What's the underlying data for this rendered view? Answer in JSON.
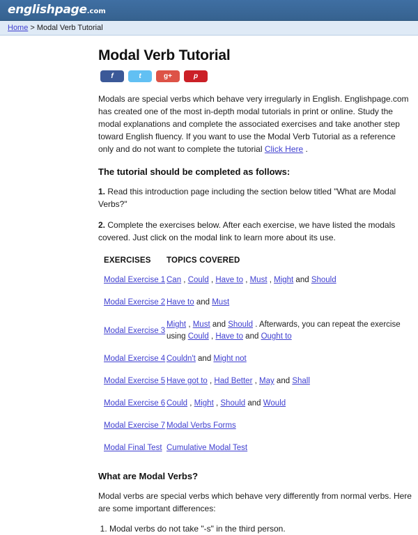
{
  "site": {
    "logo_name": "englishpage",
    "logo_tld": ".com"
  },
  "breadcrumb": {
    "home_label": "Home",
    "separator": " > ",
    "current": "Modal Verb Tutorial"
  },
  "page": {
    "title": "Modal Verb Tutorial"
  },
  "social": {
    "buttons": [
      {
        "name": "facebook-share-button",
        "label": "f",
        "color": "#3b5998"
      },
      {
        "name": "twitter-share-button",
        "label": "t",
        "color": "#62c0f3"
      },
      {
        "name": "googleplus-share-button",
        "label": "g+",
        "color": "#dd5347"
      },
      {
        "name": "pinterest-share-button",
        "label": "p",
        "color": "#cb2027"
      }
    ]
  },
  "intro": {
    "part1": "Modals are special verbs which behave very irregularly in English. Englishpage.com has created one of the most in-depth modal tutorials in print or online. Study the modal explanations and complete the associated exercises and take another step toward English fluency. If you want to use the Modal Verb Tutorial as a reference only and do not want to complete the tutorial ",
    "click_here": "Click Here",
    "part2": " ."
  },
  "steps": {
    "heading": "The tutorial should be completed as follows:",
    "one_num": "1.",
    "one_text": " Read this introduction page including the section below titled \"What are Modal Verbs?\"",
    "two_num": "2.",
    "two_text": " Complete the exercises below. After each exercise, we have listed the modals covered. Just click on the modal link to learn more about its use."
  },
  "exercises_table": {
    "header_exercises": "EXERCISES",
    "header_topics": "TOPICS COVERED",
    "rows": [
      {
        "exercise": "Modal Exercise 1",
        "topics_plain": "Can , Could , Have to , Must , Might and Should",
        "topics": [
          {
            "text": "Can",
            "link": true
          },
          {
            "text": " , ",
            "link": false
          },
          {
            "text": "Could",
            "link": true
          },
          {
            "text": " , ",
            "link": false
          },
          {
            "text": "Have to",
            "link": true
          },
          {
            "text": " , ",
            "link": false
          },
          {
            "text": "Must",
            "link": true
          },
          {
            "text": " , ",
            "link": false
          },
          {
            "text": "Might",
            "link": true
          },
          {
            "text": " and ",
            "link": false
          },
          {
            "text": "Should",
            "link": true
          }
        ]
      },
      {
        "exercise": "Modal Exercise 2",
        "topics_plain": "Have to and Must",
        "topics": [
          {
            "text": "Have to",
            "link": true
          },
          {
            "text": " and ",
            "link": false
          },
          {
            "text": "Must",
            "link": true
          }
        ]
      },
      {
        "exercise": "Modal Exercise 3",
        "topics_plain": "Might , Must and Should . Afterwards, you can repeat the exercise using Could , Have to and Ought to",
        "topics": [
          {
            "text": "Might",
            "link": true
          },
          {
            "text": " , ",
            "link": false
          },
          {
            "text": "Must",
            "link": true
          },
          {
            "text": " and ",
            "link": false
          },
          {
            "text": "Should",
            "link": true
          },
          {
            "text": " . Afterwards, you can repeat the exercise using ",
            "link": false
          },
          {
            "text": "Could",
            "link": true
          },
          {
            "text": " , ",
            "link": false
          },
          {
            "text": "Have to",
            "link": true
          },
          {
            "text": " and ",
            "link": false
          },
          {
            "text": "Ought to",
            "link": true
          }
        ]
      },
      {
        "exercise": "Modal Exercise 4",
        "topics_plain": "Couldn't and Might not",
        "topics": [
          {
            "text": "Couldn't",
            "link": true
          },
          {
            "text": " and ",
            "link": false
          },
          {
            "text": "Might not",
            "link": true
          }
        ]
      },
      {
        "exercise": "Modal Exercise 5",
        "topics_plain": "Have got to , Had Better , May and Shall",
        "topics": [
          {
            "text": "Have got to",
            "link": true
          },
          {
            "text": " , ",
            "link": false
          },
          {
            "text": "Had Better",
            "link": true
          },
          {
            "text": " , ",
            "link": false
          },
          {
            "text": "May",
            "link": true
          },
          {
            "text": " and ",
            "link": false
          },
          {
            "text": "Shall",
            "link": true
          }
        ]
      },
      {
        "exercise": "Modal Exercise 6",
        "topics_plain": "Could , Might , Should and Would",
        "topics": [
          {
            "text": "Could",
            "link": true
          },
          {
            "text": " , ",
            "link": false
          },
          {
            "text": "Might",
            "link": true
          },
          {
            "text": " , ",
            "link": false
          },
          {
            "text": "Should",
            "link": true
          },
          {
            "text": " and ",
            "link": false
          },
          {
            "text": "Would",
            "link": true
          }
        ]
      },
      {
        "exercise": "Modal Exercise 7",
        "topics_plain": "Modal Verbs Forms",
        "topics": [
          {
            "text": "Modal Verbs Forms",
            "link": true
          }
        ]
      },
      {
        "exercise": "Modal Final Test",
        "topics_plain": "Cumulative Modal Test",
        "topics": [
          {
            "text": "Cumulative Modal Test",
            "link": true
          }
        ]
      }
    ]
  },
  "what_are": {
    "heading": "What are Modal Verbs?",
    "intro": "Modal verbs are special verbs which behave very differently from normal verbs. Here are some important differences:",
    "notes": [
      "Modal verbs do not take \"-s\" in the third person."
    ]
  },
  "colors": {
    "masthead_blue": "#3a6ea5",
    "breadcrumb_blue": "#dfeaf6",
    "link_blue": "#4040d0"
  }
}
